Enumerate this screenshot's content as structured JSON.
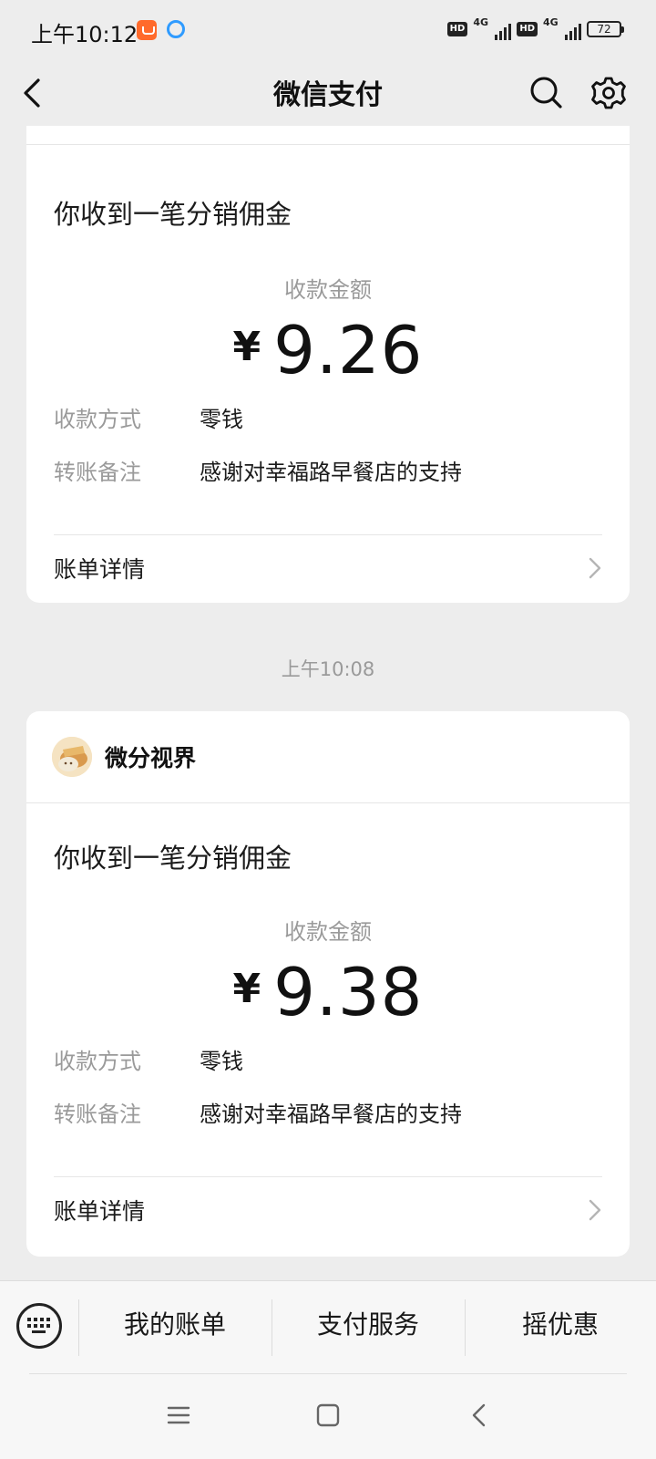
{
  "status_bar": {
    "time": "上午10:12",
    "hd_1": "HD",
    "net_1": "4G",
    "hd_2": "HD",
    "net_2": "4G",
    "battery": "72"
  },
  "nav": {
    "title": "微信支付"
  },
  "cards": [
    {
      "notice_title": "你收到一笔分销佣金",
      "amount_label": "收款金额",
      "currency": "¥",
      "amount": "9.26",
      "method_key": "收款方式",
      "method_value": "零钱",
      "note_key": "转账备注",
      "note_value": "感谢对幸福路早餐店的支持",
      "detail_label": "账单详情"
    },
    {
      "merchant_name": "微分视界",
      "notice_title": "你收到一笔分销佣金",
      "amount_label": "收款金额",
      "currency": "¥",
      "amount": "9.38",
      "method_key": "收款方式",
      "method_value": "零钱",
      "note_key": "转账备注",
      "note_value": "感谢对幸福路早餐店的支持",
      "detail_label": "账单详情"
    }
  ],
  "time_separator": "上午10:08",
  "bottom_menu": {
    "items": [
      "我的账单",
      "支付服务",
      "摇优惠"
    ]
  }
}
